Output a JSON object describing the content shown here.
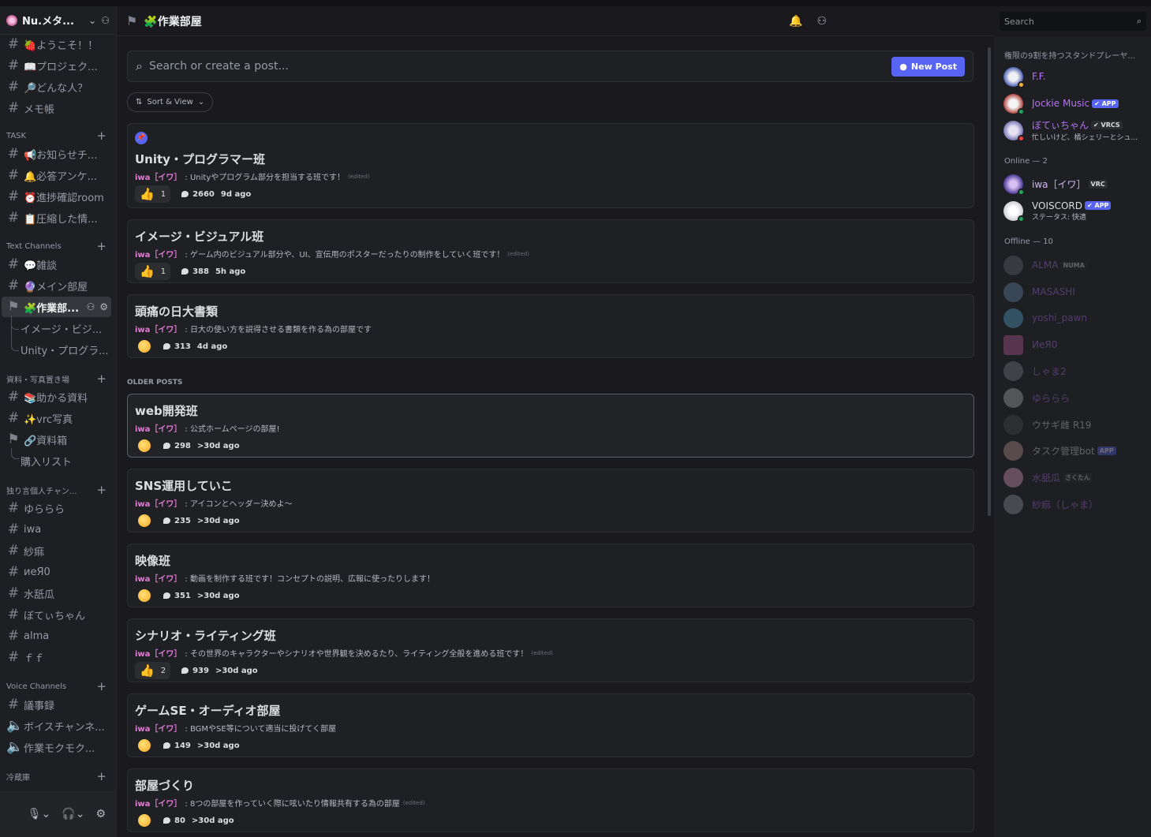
{
  "server": {
    "name": "Nu.メタ..."
  },
  "sidebar": {
    "channels": [
      {
        "label": "🍓ようこそ！！"
      },
      {
        "label": "📖プロジェク..."
      },
      {
        "label": "🔎どんな人？"
      },
      {
        "label": "メモ帳"
      }
    ],
    "task_label": "TASK",
    "task": [
      {
        "label": "📢お知らせチ..."
      },
      {
        "label": "🔔必答アンケ..."
      },
      {
        "label": "⏰進捗確認room"
      },
      {
        "label": "📋圧縮した情..."
      }
    ],
    "text_label": "Text Channels",
    "text": [
      {
        "label": "💬雑談"
      },
      {
        "label": "🔮メイン部屋"
      },
      {
        "label": "🧩作業部..."
      },
      {
        "label": "イメージ・ビジ..."
      },
      {
        "label": "Unity・プログラ..."
      }
    ],
    "material_label": "資料・写真置き場",
    "material": [
      {
        "label": "📚助かる資料"
      },
      {
        "label": "✨vrc写真"
      },
      {
        "label": "🔗資料箱"
      },
      {
        "label": "購入リスト"
      }
    ],
    "personal_label": "独り言個人チャン...",
    "personal": [
      {
        "label": "ゆららら"
      },
      {
        "label": "iwa"
      },
      {
        "label": "紗痲"
      },
      {
        "label": "иеЯ0"
      },
      {
        "label": "水舐瓜"
      },
      {
        "label": "ぼてぃちゃん"
      },
      {
        "label": "alma"
      },
      {
        "label": "ｆｆ"
      }
    ],
    "voice_label": "Voice Channels",
    "voice": [
      {
        "label": "議事録"
      },
      {
        "label": "ボイスチャンネ..."
      },
      {
        "label": "作業モクモク..."
      }
    ],
    "fridge_label": "冷蔵庫"
  },
  "header": {
    "title": "🧩作業部屋",
    "search_placeholder": "Search"
  },
  "forum": {
    "search_placeholder": "Search or create a post...",
    "new_post": "New Post",
    "sort_label": "Sort & View",
    "older_label": "OLDER POSTS",
    "posts": [
      {
        "title": "Unity・プログラマー班",
        "author": "iwa［イワ］",
        "text": ": Unityやプログラム部分を担当する班です！",
        "edited": "(edited)",
        "reaction": "1",
        "comments": "2660",
        "ago": "9d ago"
      },
      {
        "title": "イメージ・ビジュアル班",
        "author": "iwa［イワ］",
        "text": ": ゲーム内のビジュアル部分や、UI、宣伝用のポスターだったりの制作をしていく班です！",
        "edited": "(edited)",
        "reaction": "1",
        "comments": "388",
        "ago": "5h ago"
      },
      {
        "title": "頭痛の日大書類",
        "author": "iwa［イワ］",
        "text": ": 日大の使い方を説得させる書類を作る為の部屋です",
        "edited": "",
        "reaction": "",
        "comments": "313",
        "ago": "4d ago"
      },
      {
        "title": "web開発班",
        "author": "iwa［イワ］",
        "text": ": 公式ホームページの部屋!",
        "edited": "",
        "reaction": "",
        "comments": "298",
        "ago": ">30d ago"
      },
      {
        "title": "SNS運用していこ",
        "author": "iwa［イワ］",
        "text": ": アイコンとヘッダー決めよ～",
        "edited": "",
        "reaction": "",
        "comments": "235",
        "ago": ">30d ago"
      },
      {
        "title": "映像班",
        "author": "iwa［イワ］",
        "text": ": 動画を制作する班です！コンセプトの説明、広報に使ったりします！",
        "edited": "",
        "reaction": "",
        "comments": "351",
        "ago": ">30d ago"
      },
      {
        "title": "シナリオ・ライティング班",
        "author": "iwa［イワ］",
        "text": ": その世界のキャラクターやシナリオや世界観を決めるたり、ライティング全般を進める班です！",
        "edited": "(edited)",
        "reaction": "2",
        "comments": "939",
        "ago": ">30d ago"
      },
      {
        "title": "ゲームSE・オーディオ部屋",
        "author": "iwa［イワ］",
        "text": ": BGMやSE等について適当に投げてく部屋",
        "edited": "",
        "reaction": "",
        "comments": "149",
        "ago": ">30d ago"
      },
      {
        "title": "部屋づくり",
        "author": "iwa［イワ］",
        "text": ": 8つの部屋を作っていく際に呟いたり情報共有する為の部屋",
        "edited": "(edited)",
        "reaction": "",
        "comments": "80",
        "ago": ">30d ago"
      }
    ]
  },
  "members": {
    "role_header": "権限の9割を持つスタンドプレーヤ...",
    "online_header": "Online — 2",
    "offline_header": "Offline — 10",
    "role": [
      {
        "name": "F.F.",
        "color": "#b473f5"
      },
      {
        "name": "Jockie Music",
        "color": "#b473f5",
        "badge": "✔ APP"
      },
      {
        "name": "ぼてぃちゃん",
        "color": "#b473f5",
        "badge": "✔ VRCS",
        "status": "忙しいけど、橘シェリーとシュ..."
      }
    ],
    "online": [
      {
        "name": "iwa［イワ］",
        "color": "#d5b8f7",
        "badge": "VRC"
      },
      {
        "name": "VOISCORD",
        "color": "#dbdee1",
        "badge": "✔ APP",
        "status": "ステータス: 快適"
      }
    ],
    "offline": [
      {
        "name": "ALMA",
        "badge": "NUMA"
      },
      {
        "name": "MASASHI"
      },
      {
        "name": "yoshi_pawn"
      },
      {
        "name": "ИеЯ0"
      },
      {
        "name": "しゃま2"
      },
      {
        "name": "ゆららら"
      },
      {
        "name": "ウサギ雌 R19"
      },
      {
        "name": "タスク管理bot",
        "badge": "APP"
      },
      {
        "name": "水舐瓜",
        "badge": "さくたん"
      },
      {
        "name": "紗痲（しゃま）"
      }
    ]
  }
}
